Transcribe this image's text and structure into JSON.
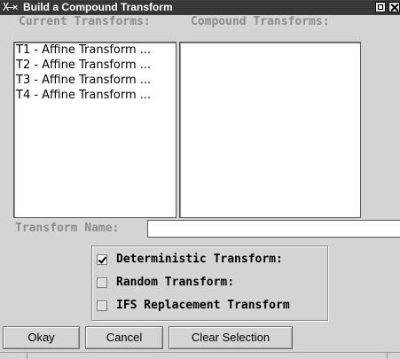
{
  "window": {
    "title": "Build a Compound Transform",
    "logo": "X—⨯",
    "controls": [
      "maximize-icon",
      "close-icon"
    ]
  },
  "headers": {
    "current": "Current Transforms:",
    "compound": "Compound Transforms:"
  },
  "current_transforms": [
    "T1 - Affine Transform ...",
    "T2 - Affine Transform ...",
    "T3 - Affine Transform ...",
    "T4 - Affine Transform ..."
  ],
  "compound_transforms": [],
  "transform_name": {
    "label": "Transform Name:",
    "value": ""
  },
  "options": [
    {
      "label": "Deterministic Transform:",
      "checked": true
    },
    {
      "label": "Random Transform:",
      "checked": false
    },
    {
      "label": "IFS Replacement Transform",
      "checked": false
    }
  ],
  "buttons": {
    "okay": "Okay",
    "cancel": "Cancel",
    "clear": "Clear Selection"
  },
  "colors": {
    "background": "#d4d4d4",
    "titlebar": "#2c2c2c",
    "disabled_text": "#8c8c8c"
  }
}
